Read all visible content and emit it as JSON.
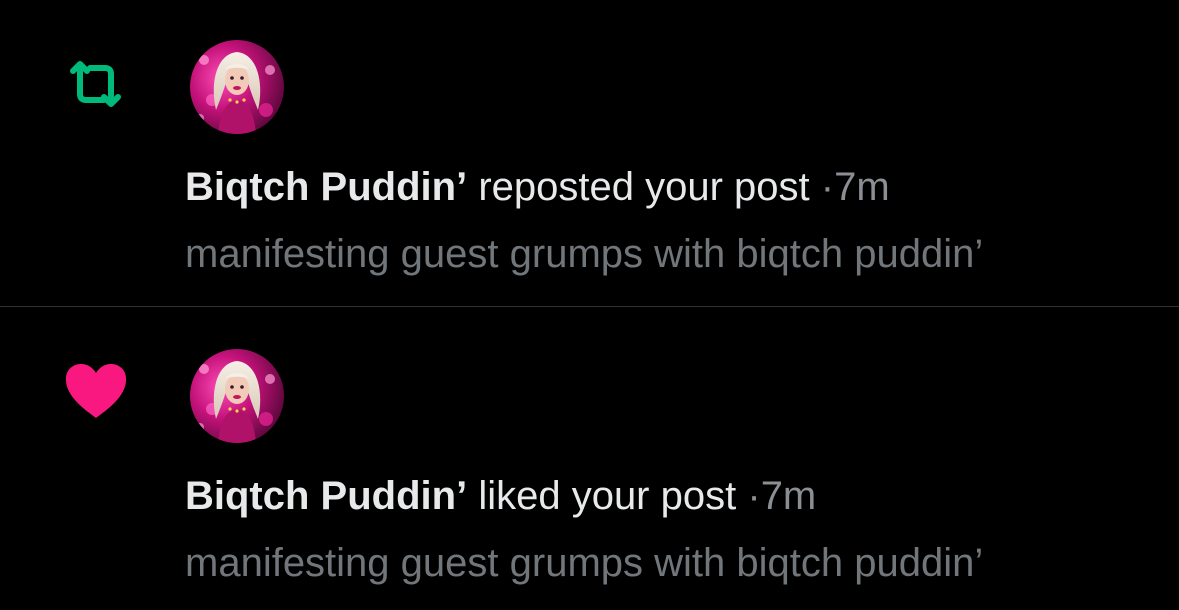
{
  "colors": {
    "background": "#000000",
    "repost_green": "#00ba7c",
    "like_pink": "#f91880",
    "primary_text": "#e7e9ea",
    "secondary_text": "#71767b",
    "divider": "#2f3336"
  },
  "notifications": [
    {
      "type": "repost",
      "icon": "repost-icon",
      "author": "Biqtch Puddin’",
      "action": "reposted your post",
      "separator": "·",
      "time": "7m",
      "post_text": "manifesting guest grumps with biqtch puddin’"
    },
    {
      "type": "like",
      "icon": "heart-icon",
      "author": "Biqtch Puddin’",
      "action": "liked your post",
      "separator": "·",
      "time": "7m",
      "post_text": "manifesting guest grumps with biqtch puddin’"
    }
  ]
}
